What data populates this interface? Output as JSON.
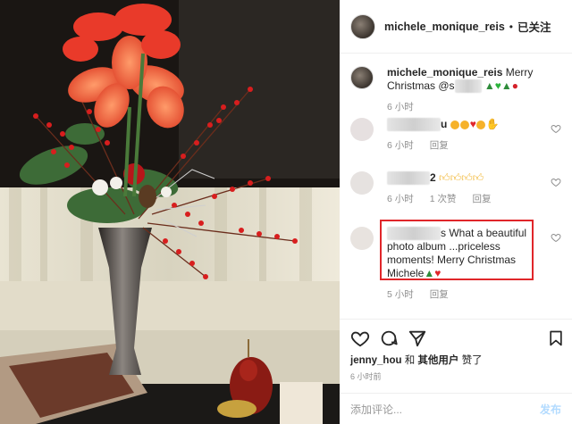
{
  "header": {
    "username": "michele_monique_reis",
    "separator": "•",
    "follow_label": "已关注"
  },
  "caption": {
    "username": "michele_monique_reis",
    "text_before": "Merry Christmas @s",
    "time": "6 小时"
  },
  "comments": [
    {
      "username_visible": "u",
      "text": "",
      "time": "6 小时",
      "reply": "回复"
    },
    {
      "username_visible": "2",
      "text": "",
      "time": "6 小时",
      "likes": "1 次赞",
      "reply": "回复"
    },
    {
      "username_visible": "s",
      "text": "What a beautiful photo album ...priceless moments! Merry Christmas Michele",
      "time": "5 小时",
      "reply": "回复"
    }
  ],
  "footer": {
    "liked_by_user": "jenny_hou",
    "liked_by_and": "和",
    "liked_by_others": "其他用户",
    "liked_by_suffix": "赞了",
    "time": "6 小时前",
    "comment_placeholder": "添加评论...",
    "post_label": "发布"
  },
  "icons": [
    "heart-icon",
    "comment-icon",
    "share-icon",
    "bookmark-icon"
  ],
  "colors": {
    "highlight_border": "#e0262a",
    "follow_text": "#262626"
  }
}
